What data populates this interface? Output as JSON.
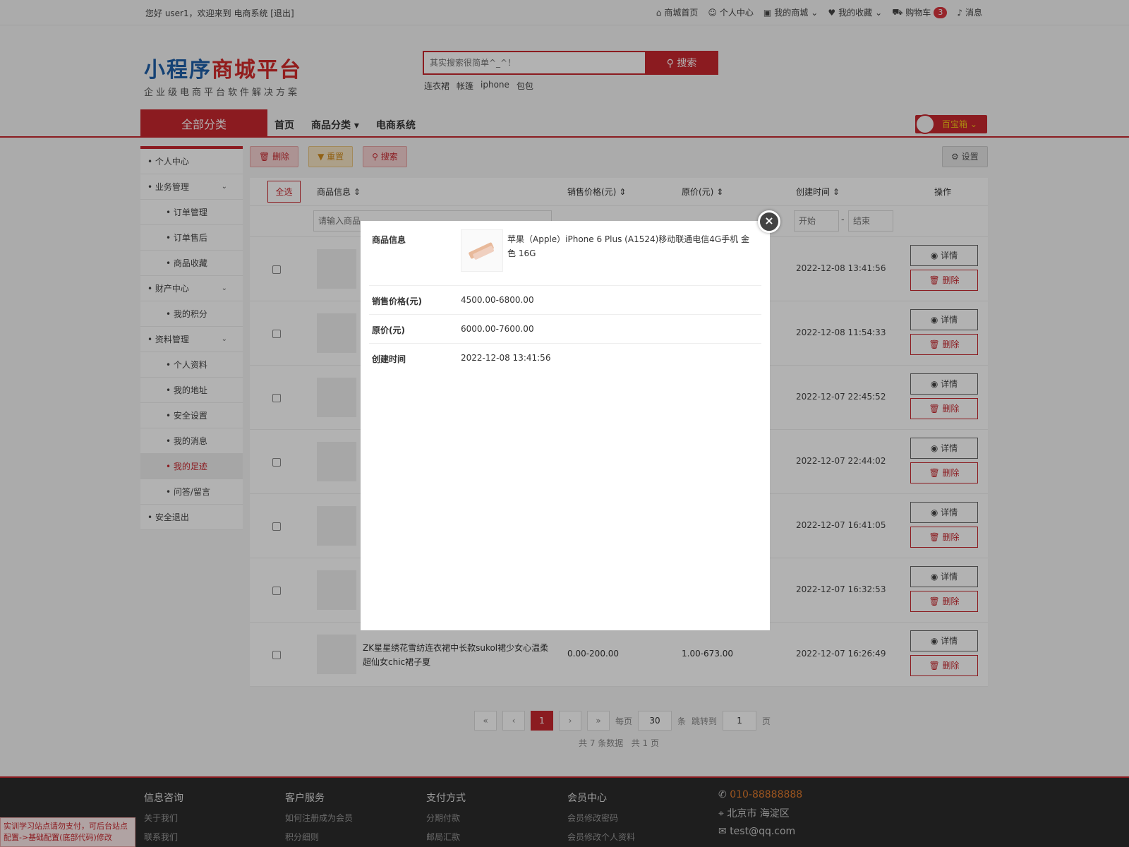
{
  "topbar": {
    "greeting": "您好 user1，欢迎来到 电商系统",
    "logout": "[退出]",
    "nav": [
      "商城首页",
      "个人中心",
      "我的商城",
      "我的收藏",
      "购物车",
      "消息"
    ],
    "cart_count": "3"
  },
  "logo": {
    "blue_text": "小程序",
    "red_text": "商城平台",
    "subtitle": "企业级电商平台软件解决方案"
  },
  "search": {
    "placeholder": "其实搜索很简单^_^！",
    "button": "搜索",
    "hotwords": [
      "连衣裙",
      "帐篷",
      "iphone",
      "包包"
    ]
  },
  "catbar": {
    "all": "全部分类",
    "nav": [
      "首页",
      "商品分类",
      "电商系统"
    ],
    "box": "百宝箱"
  },
  "sidebar": {
    "items": [
      {
        "label": "个人中心",
        "child": false,
        "chev": false
      },
      {
        "label": "业务管理",
        "child": false,
        "chev": true
      },
      {
        "label": "订单管理",
        "child": true,
        "chev": false
      },
      {
        "label": "订单售后",
        "child": true,
        "chev": false
      },
      {
        "label": "商品收藏",
        "child": true,
        "chev": false
      },
      {
        "label": "财产中心",
        "child": false,
        "chev": true
      },
      {
        "label": "我的积分",
        "child": true,
        "chev": false
      },
      {
        "label": "资料管理",
        "child": false,
        "chev": true
      },
      {
        "label": "个人资料",
        "child": true,
        "chev": false
      },
      {
        "label": "我的地址",
        "child": true,
        "chev": false
      },
      {
        "label": "安全设置",
        "child": true,
        "chev": false
      },
      {
        "label": "我的消息",
        "child": true,
        "chev": false
      },
      {
        "label": "我的足迹",
        "child": true,
        "chev": false,
        "active": true
      },
      {
        "label": "问答/留言",
        "child": true,
        "chev": false
      },
      {
        "label": "安全退出",
        "child": false,
        "chev": false
      }
    ]
  },
  "toolbar": {
    "delete": "删除",
    "reset": "重置",
    "search": "搜索",
    "settings": "设置"
  },
  "table": {
    "select_all": "全选",
    "headers": [
      "商品信息",
      "销售价格(元)",
      "原价(元)",
      "创建时间",
      "操作"
    ],
    "filter_placeholder": "请输入商品",
    "date_start": "开始",
    "date_end": "结束",
    "detail_btn": "详情",
    "delete_btn": "删除",
    "rows": [
      {
        "name": "",
        "price": "",
        "orig": "",
        "time": "2022-12-08 13:41:56"
      },
      {
        "name": "",
        "price": "",
        "orig": "",
        "time": "2022-12-08 11:54:33"
      },
      {
        "name": "",
        "price": "",
        "orig": "",
        "time": "2022-12-07 22:45:52"
      },
      {
        "name": "",
        "price": "",
        "orig": "",
        "time": "2022-12-07 22:44:02"
      },
      {
        "name": "",
        "price": "",
        "orig": "",
        "time": "2022-12-07 16:41:05"
      },
      {
        "name": "",
        "price": "",
        "orig": "",
        "time": "2022-12-07 16:32:53"
      },
      {
        "name": "ZK星星绣花雪纺连衣裙中长款sukol裙少女心温柔超仙女chic裙子夏",
        "price": "0.00-200.00",
        "orig": "1.00-673.00",
        "time": "2022-12-07 16:26:49"
      }
    ]
  },
  "pager": {
    "first": "«",
    "prev": "‹",
    "current": "1",
    "next": "›",
    "last": "»",
    "per_page_label": "每页",
    "per_page": "30",
    "per_unit": "条",
    "jump_label": "跳转到",
    "jump_value": "1",
    "page_unit": "页",
    "summary": "共 7 条数据   共 1 页"
  },
  "footer": {
    "cols": [
      {
        "title": "信息咨询",
        "links": [
          "关于我们",
          "联系我们"
        ]
      },
      {
        "title": "客户服务",
        "links": [
          "如何注册成为会员",
          "积分细则"
        ]
      },
      {
        "title": "支付方式",
        "links": [
          "分期付款",
          "邮局汇款"
        ]
      },
      {
        "title": "会员中心",
        "links": [
          "会员修改密码",
          "会员修改个人资料"
        ]
      }
    ],
    "phone": "010-88888888",
    "address": "北京市 海淀区",
    "email": "test@qq.com"
  },
  "notice": "实训学习站点请勿支付，可后台站点配置->基础配置(底部代码)修改",
  "modal": {
    "label_info": "商品信息",
    "product_name": "苹果（Apple）iPhone 6 Plus (A1524)移动联通电信4G手机 金色 16G",
    "label_price": "销售价格(元)",
    "price": "4500.00-6800.00",
    "label_orig": "原价(元)",
    "orig": "6000.00-7600.00",
    "label_time": "创建时间",
    "time": "2022-12-08 13:41:56",
    "close_glyph": "×"
  },
  "colors": {
    "brand_red": "#c8282f",
    "logo_blue": "#1f5fa8",
    "footer_bg": "#2b2b2b"
  }
}
